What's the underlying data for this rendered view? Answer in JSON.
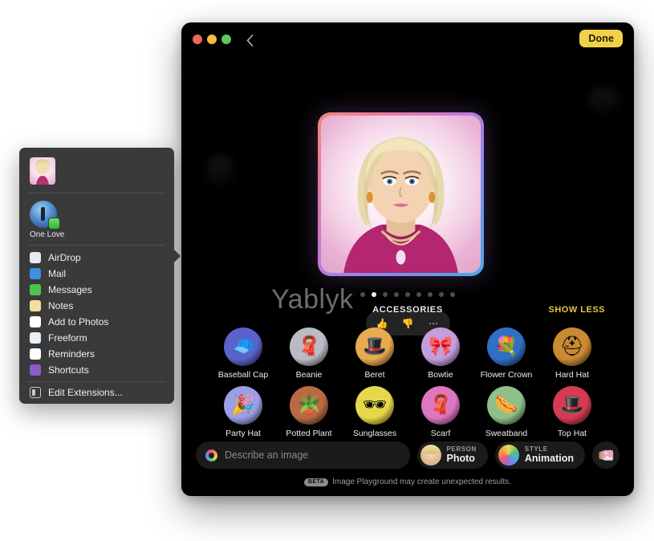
{
  "window": {
    "traffic_lights": [
      "close",
      "minimize",
      "zoom"
    ],
    "back_label": "Back",
    "done_label": "Done",
    "done_color": "#f2d14a"
  },
  "stage": {
    "watermark": "Yablyk",
    "page_dots": {
      "count": 9,
      "active_index": 1
    },
    "feedback": [
      {
        "name": "thumbs-up",
        "glyph": "👍"
      },
      {
        "name": "thumbs-down",
        "glyph": "👎"
      },
      {
        "name": "more-options",
        "glyph": "⋯"
      }
    ]
  },
  "accessories": {
    "title": "ACCESSORIES",
    "show_less_label": "SHOW LESS",
    "show_less_color": "#e8c545",
    "rows": [
      [
        {
          "label": "Baseball Cap",
          "glyph": "🧢",
          "bg": "#5b62c9"
        },
        {
          "label": "Beanie",
          "glyph": "🧣",
          "bg": "#b9bcc4"
        },
        {
          "label": "Beret",
          "glyph": "🎩",
          "bg": "#e8ab50"
        },
        {
          "label": "Bowtie",
          "glyph": "🎀",
          "bg": "#c49ddd"
        },
        {
          "label": "Flower Crown",
          "glyph": "💐",
          "bg": "#2f6fc4"
        },
        {
          "label": "Hard Hat",
          "glyph": "⛑",
          "bg": "#c98a33"
        }
      ],
      [
        {
          "label": "Party Hat",
          "glyph": "🎉",
          "bg": "#9aa0e6"
        },
        {
          "label": "Potted Plant",
          "glyph": "🪴",
          "bg": "#b96a45"
        },
        {
          "label": "Sunglasses",
          "glyph": "🕶",
          "bg": "#e7d84b"
        },
        {
          "label": "Scarf",
          "glyph": "🧣",
          "bg": "#dd78c0"
        },
        {
          "label": "Sweatband",
          "glyph": "🌭",
          "bg": "#8dc08a"
        },
        {
          "label": "Top Hat",
          "glyph": "🎩",
          "bg": "#d93a52"
        }
      ]
    ]
  },
  "toolbar": {
    "describe_placeholder": "Describe an image",
    "describe_value": "",
    "person_chip": {
      "kicker": "PERSON",
      "value": "Photo"
    },
    "style_chip": {
      "kicker": "STYLE",
      "value": "Animation"
    },
    "photo_picker_name": "photo-library-button",
    "beta_badge": "BETA",
    "beta_text": "Image Playground may create unexpected results."
  },
  "share_menu": {
    "airdrop_target": {
      "label": "One Love"
    },
    "items": [
      {
        "label": "AirDrop",
        "color": "#e8eaf2"
      },
      {
        "label": "Mail",
        "color": "#3f8ee0"
      },
      {
        "label": "Messages",
        "color": "#4cc34c"
      },
      {
        "label": "Notes",
        "color": "#f2dfa0"
      },
      {
        "label": "Add to Photos",
        "color": "#ffffff"
      },
      {
        "label": "Freeform",
        "color": "#e8f0f8"
      },
      {
        "label": "Reminders",
        "color": "#ffffff"
      },
      {
        "label": "Shortcuts",
        "color": "#8b5cc9"
      }
    ],
    "edit_extensions_label": "Edit Extensions..."
  }
}
